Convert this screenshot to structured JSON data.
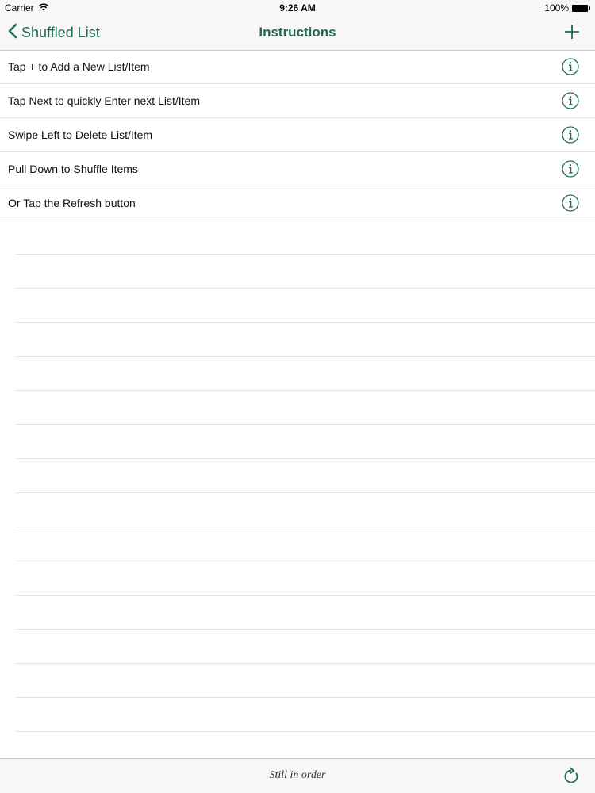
{
  "status_bar": {
    "carrier": "Carrier",
    "time": "9:26 AM",
    "battery": "100%"
  },
  "nav": {
    "back_label": "Shuffled List",
    "title": "Instructions"
  },
  "items": [
    {
      "label": "Tap + to Add a New List/Item"
    },
    {
      "label": "Tap Next to quickly Enter next List/Item"
    },
    {
      "label": "Swipe Left to Delete List/Item"
    },
    {
      "label": "Pull Down to Shuffle Items"
    },
    {
      "label": "Or Tap the Refresh button"
    }
  ],
  "toolbar": {
    "status_text": "Still in order"
  },
  "icons": {
    "back": "chevron-left-icon",
    "add": "plus-icon",
    "info": "info-icon",
    "refresh": "refresh-icon",
    "wifi": "wifi-icon",
    "battery": "battery-icon"
  },
  "colors": {
    "accent": "#1e6b4e"
  }
}
